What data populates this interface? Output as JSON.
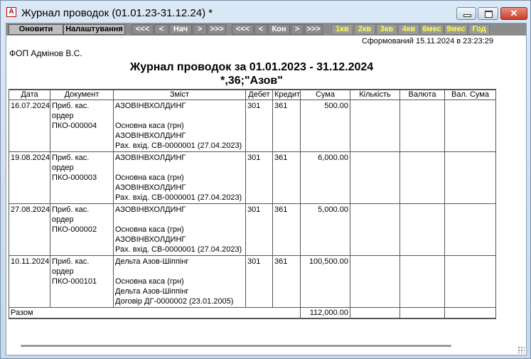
{
  "window": {
    "title": "Журнал проводок (01.01.23-31.12.24)  *",
    "app_icon_glyph": "A"
  },
  "toolbar": {
    "refresh": "Оновити",
    "settings": "Налаштування",
    "nav_first": "<<<",
    "nav_prev": "<",
    "nav_start": "Нач",
    "nav_next": ">",
    "nav_last": ">>>",
    "nav2_first": "<<<",
    "nav2_prev": "<",
    "nav2_end": "Кон",
    "nav2_next": ">",
    "nav2_last": ">>>",
    "periods": [
      "1кв",
      "2кв",
      "3кв",
      "4кв",
      "6мес",
      "9мес",
      "Год"
    ]
  },
  "report": {
    "generated": "Сформований 15.11.2024 в 23:23:29",
    "organization": "ФОП Адмінов В.С.",
    "title": "Журнал проводок за 01.01.2023 - 31.12.2024",
    "subtitle": "*,36;\"Азов\"",
    "columns": [
      "Дата",
      "Документ",
      "Зміст",
      "Дебет",
      "Кредит",
      "Сума",
      "Кількість",
      "Валюта",
      "Вал. Сума"
    ],
    "rows": [
      {
        "date": "16.07.2024",
        "doc": [
          "Приб. кас.",
          "ордер",
          "ПКО-000004"
        ],
        "content": [
          "АЗОВІНВХОЛДИНГ",
          "",
          "Основна каса (грн)",
          "АЗОВІНВХОЛДИНГ",
          "Рах. вхід. СВ-0000001 (27.04.2023)"
        ],
        "debit": "301",
        "credit": "361",
        "amount": "500.00",
        "qty": "",
        "currency": "",
        "cur_amount": ""
      },
      {
        "date": "19.08.2024",
        "doc": [
          "Приб. кас.",
          "ордер",
          "ПКО-000003"
        ],
        "content": [
          "АЗОВІНВХОЛДИНГ",
          "",
          "Основна каса (грн)",
          "АЗОВІНВХОЛДИНГ",
          "Рах. вхід. СВ-0000001 (27.04.2023)"
        ],
        "debit": "301",
        "credit": "361",
        "amount": "6,000.00",
        "qty": "",
        "currency": "",
        "cur_amount": ""
      },
      {
        "date": "27.08.2024",
        "doc": [
          "Приб. кас.",
          "ордер",
          "ПКО-000002"
        ],
        "content": [
          "АЗОВІНВХОЛДИНГ",
          "",
          "Основна каса (грн)",
          "АЗОВІНВХОЛДИНГ",
          "Рах. вхід. СВ-0000001 (27.04.2023)"
        ],
        "debit": "301",
        "credit": "361",
        "amount": "5,000.00",
        "qty": "",
        "currency": "",
        "cur_amount": ""
      },
      {
        "date": "10.11.2024",
        "doc": [
          "Приб. кас.",
          "ордер",
          "ПКО-000101"
        ],
        "content": [
          "Дельта Азов-Шіппінг",
          "",
          "Основна каса (грн)",
          "Дельта Азов-Шіппінг",
          "Договір ДГ-0000002 (23.01.2005)"
        ],
        "debit": "301",
        "credit": "361",
        "amount": "100,500.00",
        "qty": "",
        "currency": "",
        "cur_amount": ""
      }
    ],
    "total_label": "Разом",
    "total_amount": "112,000.00"
  }
}
